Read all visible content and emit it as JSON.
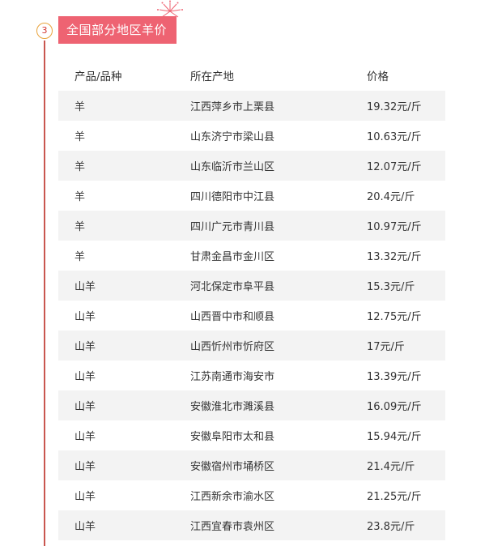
{
  "section": {
    "step_number": "3",
    "title": "全国部分地区羊价"
  },
  "table": {
    "headers": [
      "产品/品种",
      "所在产地",
      "价格"
    ],
    "rows": [
      {
        "product": "羊",
        "origin": "江西萍乡市上栗县",
        "price": "19.32元/斤"
      },
      {
        "product": "羊",
        "origin": "山东济宁市梁山县",
        "price": "10.63元/斤"
      },
      {
        "product": "羊",
        "origin": "山东临沂市兰山区",
        "price": "12.07元/斤"
      },
      {
        "product": "羊",
        "origin": "四川德阳市中江县",
        "price": "20.4元/斤"
      },
      {
        "product": "羊",
        "origin": "四川广元市青川县",
        "price": "10.97元/斤"
      },
      {
        "product": "羊",
        "origin": "甘肃金昌市金川区",
        "price": "13.32元/斤"
      },
      {
        "product": "山羊",
        "origin": "河北保定市阜平县",
        "price": "15.3元/斤"
      },
      {
        "product": "山羊",
        "origin": "山西晋中市和顺县",
        "price": "12.75元/斤"
      },
      {
        "product": "山羊",
        "origin": "山西忻州市忻府区",
        "price": "17元/斤"
      },
      {
        "product": "山羊",
        "origin": "江苏南通市海安市",
        "price": "13.39元/斤"
      },
      {
        "product": "山羊",
        "origin": "安徽淮北市濉溪县",
        "price": "16.09元/斤"
      },
      {
        "product": "山羊",
        "origin": "安徽阜阳市太和县",
        "price": "15.94元/斤"
      },
      {
        "product": "山羊",
        "origin": "安徽宿州市埇桥区",
        "price": "21.4元/斤"
      },
      {
        "product": "山羊",
        "origin": "江西新余市渝水区",
        "price": "21.25元/斤"
      },
      {
        "product": "山羊",
        "origin": "江西宜春市袁州区",
        "price": "23.8元/斤"
      }
    ]
  },
  "colors": {
    "title_bg": "#ee6372",
    "timeline": "#c9564f",
    "badge_border": "#e8a23a",
    "row_shade": "#f3f3f3"
  }
}
